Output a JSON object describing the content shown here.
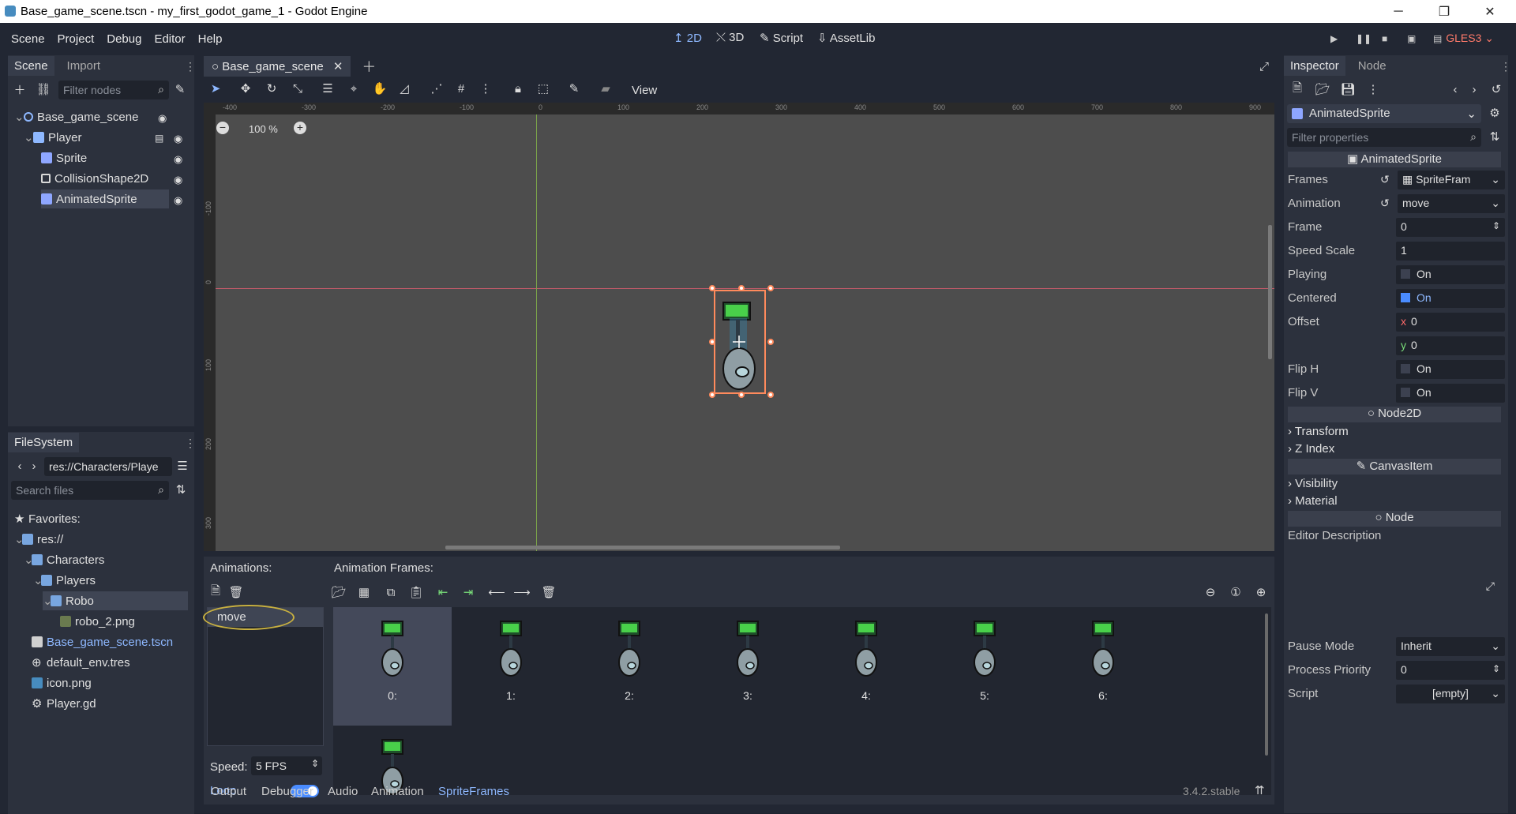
{
  "window": {
    "title": "Base_game_scene.tscn - my_first_godot_game_1 - Godot Engine",
    "controls": [
      "─",
      "❐",
      "✕"
    ]
  },
  "menu": {
    "items": [
      "Scene",
      "Project",
      "Debug",
      "Editor",
      "Help"
    ]
  },
  "main_screens": {
    "items": [
      "2D",
      "3D",
      "Script",
      "AssetLib"
    ]
  },
  "renderer": "GLES3",
  "scene_dock": {
    "tabs": [
      "Scene",
      "Import"
    ],
    "filter_placeholder": "Filter nodes",
    "tree": [
      {
        "label": "Base_game_scene",
        "depth": 0
      },
      {
        "label": "Player",
        "depth": 1
      },
      {
        "label": "Sprite",
        "depth": 2
      },
      {
        "label": "CollisionShape2D",
        "depth": 2
      },
      {
        "label": "AnimatedSprite",
        "depth": 2
      }
    ]
  },
  "filesystem": {
    "tab": "FileSystem",
    "path": "res://Characters/Playe",
    "search_placeholder": "Search files",
    "tree": [
      {
        "label": "Favorites:"
      },
      {
        "label": "res://"
      },
      {
        "label": "Characters"
      },
      {
        "label": "Players"
      },
      {
        "label": "Robo"
      },
      {
        "label": "robo_2.png"
      },
      {
        "label": "Base_game_scene.tscn"
      },
      {
        "label": "default_env.tres"
      },
      {
        "label": "icon.png"
      },
      {
        "label": "Player.gd"
      }
    ]
  },
  "editor_tab": {
    "label": "Base_game_scene"
  },
  "canvas_toolbar": {
    "view_label": "View"
  },
  "zoom": {
    "label": "100 %"
  },
  "ruler": {
    "h_ticks": [
      "-400",
      "-300",
      "-200",
      "-100",
      "0",
      "100",
      "200",
      "300",
      "400",
      "500",
      "600",
      "700",
      "800",
      "900"
    ],
    "v_ticks": [
      "-100",
      "0",
      "100",
      "200",
      "300"
    ]
  },
  "sprite_frames": {
    "animations_label": "Animations:",
    "frames_label": "Animation Frames:",
    "animation_name": "move",
    "speed_label": "Speed:",
    "speed_value": "5 FPS",
    "loop_label": "Loop",
    "frames": [
      "0:",
      "1:",
      "2:",
      "3:",
      "4:",
      "5:",
      "6:"
    ]
  },
  "bottom_panel": {
    "tabs": [
      "Output",
      "Debugger",
      "Audio",
      "Animation",
      "SpriteFrames"
    ],
    "version": "3.4.2.stable"
  },
  "inspector": {
    "tabs": [
      "Inspector",
      "Node"
    ],
    "object": "AnimatedSprite",
    "filter_placeholder": "Filter properties",
    "class_header": "AnimatedSprite",
    "props": {
      "frames": {
        "label": "Frames",
        "value": "SpriteFram"
      },
      "animation": {
        "label": "Animation",
        "value": "move"
      },
      "frame": {
        "label": "Frame",
        "value": "0"
      },
      "speed_scale": {
        "label": "Speed Scale",
        "value": "1"
      },
      "playing": {
        "label": "Playing",
        "value": "On"
      },
      "centered": {
        "label": "Centered",
        "value": "On"
      },
      "offset": {
        "label": "Offset",
        "x_label": "x",
        "x": "0",
        "y_label": "y",
        "y": "0"
      },
      "flip_h": {
        "label": "Flip H",
        "value": "On"
      },
      "flip_v": {
        "label": "Flip V",
        "value": "On"
      }
    },
    "sections": {
      "node2d": "Node2D",
      "transform": "Transform",
      "zindex": "Z Index",
      "canvasitem": "CanvasItem",
      "visibility": "Visibility",
      "material": "Material",
      "node": "Node"
    },
    "editor_description": "Editor Description",
    "pause_mode": {
      "label": "Pause Mode",
      "value": "Inherit"
    },
    "process_priority": {
      "label": "Process Priority",
      "value": "0"
    },
    "script": {
      "label": "Script",
      "value": "[empty]"
    }
  }
}
